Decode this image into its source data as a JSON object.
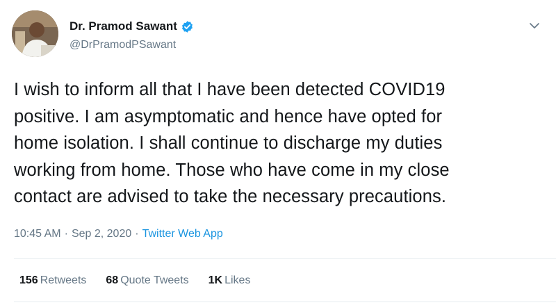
{
  "author": {
    "display_name": "Dr. Pramod Sawant",
    "handle": "@DrPramodPSawant",
    "verified_icon": "verified-badge-icon",
    "avatar_icon": "profile-photo"
  },
  "tweet": {
    "text": "I wish to inform all that I have been detected COVID19\npositive. I am asymptomatic and hence have opted for\nhome isolation. I shall continue to discharge my duties\nworking from home. Those who have come in my close\ncontact are advised to take the necessary precautions.",
    "time": "10:45 AM",
    "separator": "·",
    "date": "Sep 2, 2020",
    "source": "Twitter Web App"
  },
  "stats": {
    "retweets_count": "156",
    "retweets_label": "Retweets",
    "quote_count": "68",
    "quote_label": "Quote Tweets",
    "likes_count": "1K",
    "likes_label": "Likes"
  },
  "colors": {
    "accent": "#1b95e0",
    "muted": "#657786",
    "text": "#14171a",
    "divider": "#e6ecf0"
  }
}
